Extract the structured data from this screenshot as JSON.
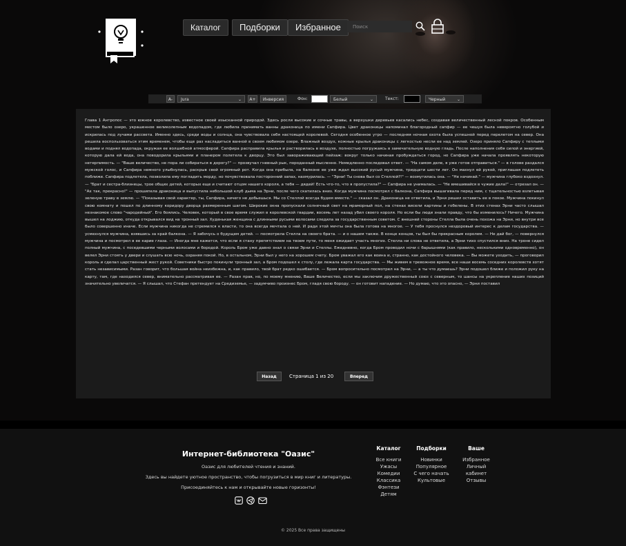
{
  "nav": {
    "catalog": "Каталог",
    "collections": "Подборки",
    "favorites": "Избранное",
    "search_placeholder": "Поиск"
  },
  "toolbar": {
    "font_decrease": "A-",
    "font_family": "Jura",
    "font_increase": "A+",
    "invert": "Инверсия",
    "bg_label": "Фон:",
    "bg_color_name": "Белый",
    "text_label": "Текст:",
    "text_color_name": "Черный"
  },
  "reader": {
    "text": "Глава 1 Антропос — это южное королевство, известное своей изысканной природой. Здесь росли высокие и сочные травы, а верхушки деревьев касались небес, создавая величественный лесной покров. Особенным местом было озеро, украшенное великолепным водопадом, где любила принимать ванны драконица по имени Сапфира. Цвет драконицы напоминал благородный сапфир — ее чешуя была невероятно голубой и искрилась под лучами рассвета. Именно здесь, среди воды и солнца, она чувствовала себя настоящей королевой. Сегодня особенное утро — последняя ночная охота была успешной перед перелетом на север. Она решила воспользоваться этим временем, чтобы еще раз насладиться ванной в своем любимом озере. Влажный воздух, кожные крылья драконицы с легкостью несли ее над землей. Озеро приняло Сапфиру с теплыми водами и поднял водопада, окружая ее волшебной атмосферой. Сапфира расправила крылья и растворилась в воздухе, полностью погружаясь в замечательную водную гладь. После наполнения себя силой и энергией, которую дала ей вода, она поводорила крыльями и планером полетела к дворцу. Это был завораживающий пейзаж: вокруг только начиная пробуждаться город, но Сапфира уже начала проявлять некоторую нетерпимость. — \"Ваше величество, не пора ли собираться в дорогу?\" — прозвучал гневный рык, породанный мысленно. Немедленно последовал ответ. — \"На самом деле, я уже готов отправиться.\" — в голове раздался мужской голос, и Сапфира немного улыбнулась, раскрыв свой огромный рот. Когда она прибыла, на балконе ее уже ждал высокий русый мужчина, тридцати шести лет. Он махнул ей рукой, приглашая подлететь поближе. Сапфира подлетела, позволила ему погладить морду, но почувствовала посторонний запах, нахмурилась. — \"Эрни! Ты снова был со Стеллой?!\" — возмутилась она. — \"Не начинай.\" — мужчина глубоко вздохнул. — \"Брат и сестра-близнецы, трое общих детей, которых еще и считают отцом нашего короля, а тебя — дядей! Есть что-то, что я пропустила?\" — Сапфира не унималась. — \"Не вмешивайся в чужие дела!\" — отрезал он. — \"Ах так, прекрасно!\" — прошипела драконица и выпустила небольшой клуб дыма на Эрни, после чего скатилась вниз. Когда мужчина посмотрел с балкона, Сапфира вышагивала перед ним, с тщательностью взлетывая зеленую траву в землю. — \"Показывая свой характер, ты, Сапфира, ничего не добьешься. Мы со Стеллой всегда будем вместе.\" — сказал он. Драконица не ответила, и Эрни решил оставить ее в покое. Мужчина покинул свою комнату и пошел по длинному коридору дворца размеренным шагом. Широкие окна пропускали солнечный свет на мраморный пол, на стенах висели картины и гобелены. В этих стенах Эрни часто слышал незнакомое слово \"чародейный\". Его боялись. Человек, который в свое время служил в королевской гвардии, восемь лет назад убил своего короля. Но если бы люди знали правду, что бы изменилось? Ничего. Мужчина вышел на лоджию, откуда открывался вид на тронный зал. Худенькая женщина с длинными русыми волосами следила за государственным советом. С внешней стороны Стелла была очень похожа на Эрни, но внутри все было совершенно иначе. Если мужчина никогда не стремился к власти, то она всегда мечтала о ней. И ради этой мечты она была готова на многое. — У тебя проснулся нездоровый интерес к делам государства. — усмехнулся мужчина, взявшись за край балкона. — Я забочусь о будущем детей. — посмотрела Стелла на своего брата. — и о нашем также. В конце концов, ты был бы прекрасным королем. — Не дай бог, — повернулся мужчина и посмотрел в ее карие глаза. — Иногда мне кажется, что если я стану препятствием на твоем пути, то меня ожидает участь многих. Стелла ни слова не ответила, а Эрни тихо спустился вниз. На троне сидел полный мужчина, с поседевшими черными волосами и бородой. Король Бром уже давно знал о связи Эрни и Стеллы. Ежедневно, когда Бром проводил ночи с барышнями (как правило, несколькими одновременно), он велел Эрни стоять у двери и слушать всю ночь, охраняя покой. Но, в остальном, Эрни был у него на хорошем счету. Бром уважал его как воина и, странно, как достойного человека. — Вы можете уходить, — проговорил король и сделал царственный жест рукой. Советники быстро покинули тронный зал, а Бром подошел к столу, где лежала карта государства. — Мы живем в тревожное время, все наши восемь соседних королевств хотят стать независимыми. Разан говорит, что большая война неизбежна, и, как правило, твой брат редко ошибается. — Бром вопросительно посмотрел на Эрни, — а ты что думаешь? Эрни подошел ближе и положил руку на карту, там, где находился север, внимательно рассматривая ее. — Разан прав, но, по моему мнению, Ваше Величество, если мы заключим дружественный союз с северным, то шансы на укрепление наших позиций значительно увеличатся. — Я слышал, что Стефан претендует на Средиземье, — задумчиво произнес Бром, гладя свою бороду. — он готовит нападение. — Но думаю, что это опасно, — Эрни поставил",
    "prev": "Назад",
    "page_info": "Страница 1 из 20",
    "next": "Вперед"
  },
  "footer": {
    "title": "Интернет-библиотека \"Оазис\"",
    "tagline": "Оазис для любителей чтения и знаний.",
    "line2": "Здесь вы найдете уютное пространство, чтобы погрузиться в мир книг и литературы.",
    "line3": "Присоединяйтесь к нам и открывайте новые горизонты!",
    "copyright": "© 2025 Все права защищены",
    "columns": [
      {
        "title": "Каталог",
        "links": [
          "Все книги",
          "Ужасы",
          "Комедии",
          "Классика",
          "Фэнтези",
          "Детям"
        ]
      },
      {
        "title": "Подборки",
        "links": [
          "Новинки",
          "Популярное",
          "С чего начать",
          "Культовые"
        ]
      },
      {
        "title": "Ваше",
        "links": [
          "Избранное",
          "Личный кабинет",
          "Отзывы"
        ]
      }
    ]
  },
  "colors": {
    "bg_swatch": "#ffffff",
    "text_swatch": "#000000"
  }
}
